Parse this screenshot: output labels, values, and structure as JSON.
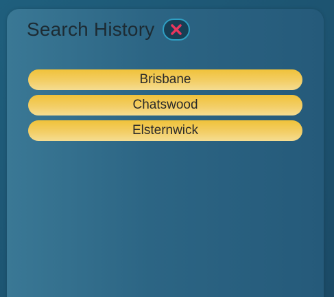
{
  "panel": {
    "title": "Search History",
    "close_icon": "close-x-icon",
    "colors": {
      "background": "#1f5f7d",
      "panel": "#2c6584",
      "item": "#f0c23a",
      "close_x": "#e8365d",
      "close_bg": "#173f55"
    }
  },
  "history": {
    "items": [
      {
        "label": "Brisbane"
      },
      {
        "label": "Chatswood"
      },
      {
        "label": "Elsternwick"
      }
    ]
  }
}
